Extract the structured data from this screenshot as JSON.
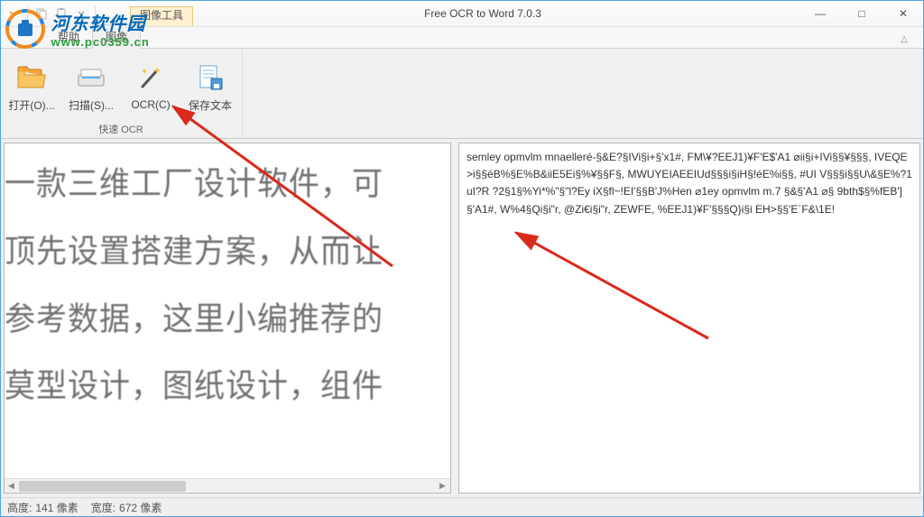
{
  "app": {
    "title": "Free OCR to Word 7.0.3",
    "qat_tooltab": "图像工具"
  },
  "window_controls": {
    "min": "—",
    "max": "□",
    "close": "✕"
  },
  "menu": {
    "help": "帮助",
    "image": "图像",
    "expand": "△"
  },
  "ribbon": {
    "open": "打开(O)...",
    "scan": "扫描(S)...",
    "ocr": "OCR(C)",
    "save": "保存文本",
    "group_label": "快速 OCR"
  },
  "left_image_text": {
    "l1": "一款三维工厂设计软件，可",
    "l2": "顶先设置搭建方案，从而让",
    "l3": "参考数据，这里小编推荐的",
    "l4": "莫型设计，图纸设计，组件"
  },
  "ocr_output": "semley opmvlm mnaelleré-§&E?§IVi§i+§'x1#, FM\\¥?EEJ1)¥F'E$'A1 ⌀ii§i+IVi§§¥§§§, IVEQE>i§§éB%§E%B&iiE5Ei§%¥§§F§, MWUYEIAEEIUd§§§i§iH§!éE%i§§, #UI V§§§i§§U\\&§E%?1uI?R ?2§1§%Yi*%\"§\"l?Ey iX§fl~!EI'§§B'J%Hen ⌀1ey opmvlm m.7 §&§'A1 ⌀§ 9bth$§%fEB']§'A1#, W%4§Qi§i\"r, @Zi€i§i\"r, ZEWFE, %EEJ1)¥F'§§§Q}i§i EH>§§'E`F&\\1E!",
  "scrollbar": {
    "left": "◀",
    "right": "▶"
  },
  "status": {
    "height_label": "高度:",
    "height_value": "141 像素",
    "width_label": "宽度:",
    "width_value": "672 像素"
  },
  "watermark": {
    "site_name": "河东软件园",
    "url": "www.pc0359.cn"
  },
  "colors": {
    "accent": "#4ea3e6",
    "ribbon_hover": "#fde8c6",
    "arrow": "#d92a1c"
  }
}
